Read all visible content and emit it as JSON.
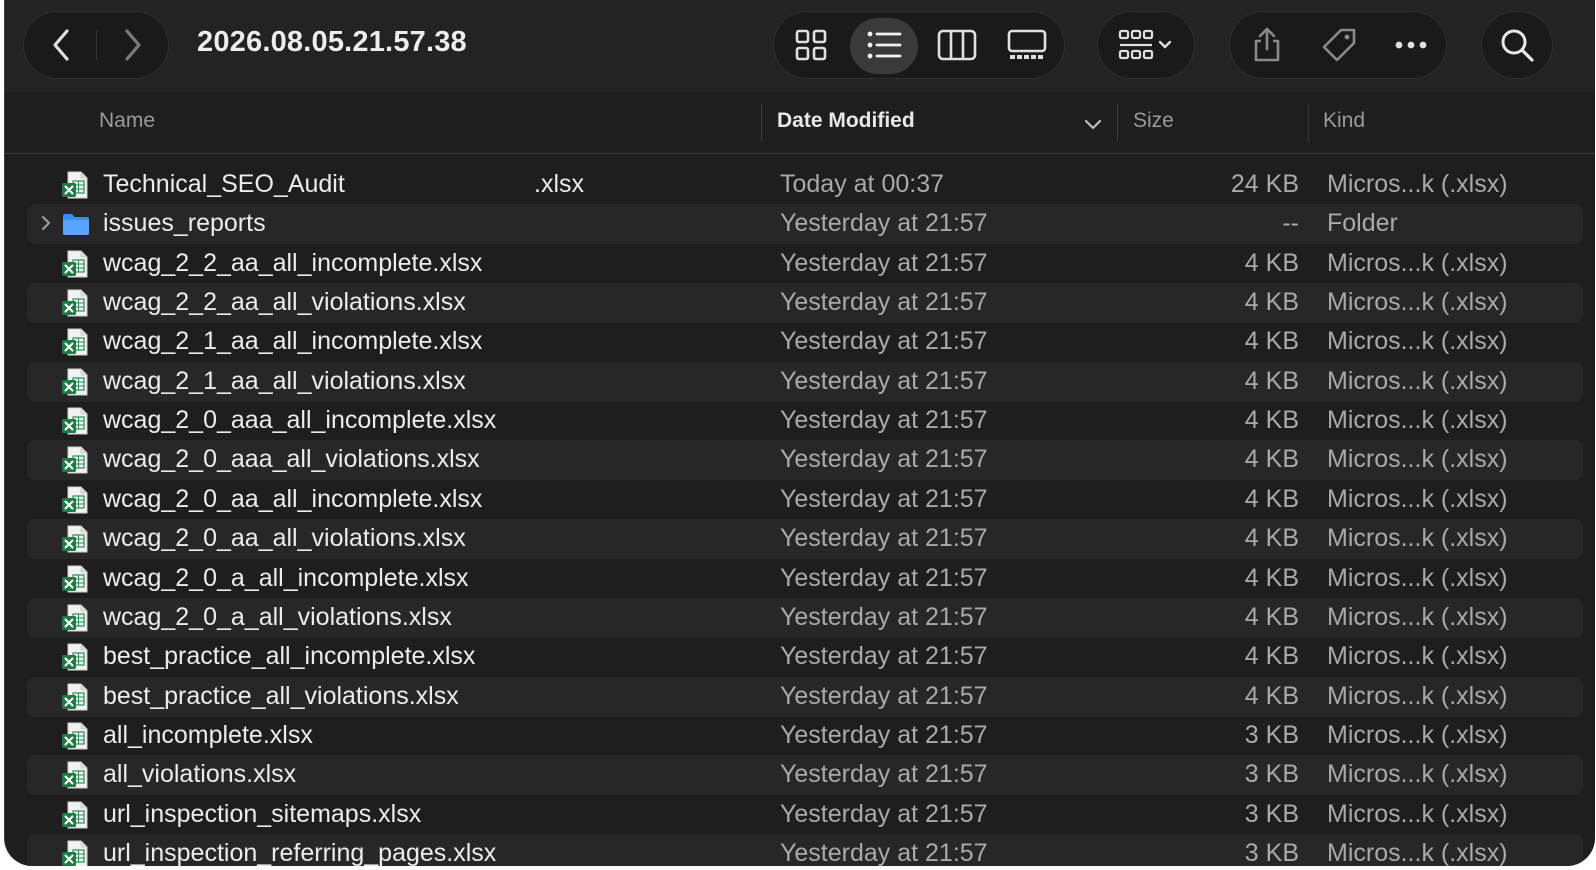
{
  "window": {
    "title": "2026.08.05.21.57.38"
  },
  "toolbar": {
    "back_icon": "chevron-left-icon",
    "forward_icon": "chevron-right-icon",
    "views": [
      "icon-view-icon",
      "list-view-icon",
      "column-view-icon",
      "gallery-view-icon"
    ],
    "active_view": "list-view-icon",
    "group_icon": "group-by-icon",
    "share_icon": "share-icon",
    "tag_icon": "tag-icon",
    "more_icon": "more-icon",
    "search_icon": "search-icon"
  },
  "columns": {
    "name": "Name",
    "date": "Date Modified",
    "size": "Size",
    "kind": "Kind"
  },
  "files": [
    {
      "name": "Technical_SEO_Audit",
      "name_suffix": ".xlsx",
      "date": "Today at 00:37",
      "size": "24 KB",
      "kind": "Micros...k (.xlsx)",
      "type": "xlsx"
    },
    {
      "name": "issues_reports",
      "date": "Yesterday at 21:57",
      "size": "--",
      "kind": "Folder",
      "type": "folder"
    },
    {
      "name": "wcag_2_2_aa_all_incomplete.xlsx",
      "date": "Yesterday at 21:57",
      "size": "4 KB",
      "kind": "Micros...k (.xlsx)",
      "type": "xlsx"
    },
    {
      "name": "wcag_2_2_aa_all_violations.xlsx",
      "date": "Yesterday at 21:57",
      "size": "4 KB",
      "kind": "Micros...k (.xlsx)",
      "type": "xlsx"
    },
    {
      "name": "wcag_2_1_aa_all_incomplete.xlsx",
      "date": "Yesterday at 21:57",
      "size": "4 KB",
      "kind": "Micros...k (.xlsx)",
      "type": "xlsx"
    },
    {
      "name": "wcag_2_1_aa_all_violations.xlsx",
      "date": "Yesterday at 21:57",
      "size": "4 KB",
      "kind": "Micros...k (.xlsx)",
      "type": "xlsx"
    },
    {
      "name": "wcag_2_0_aaa_all_incomplete.xlsx",
      "date": "Yesterday at 21:57",
      "size": "4 KB",
      "kind": "Micros...k (.xlsx)",
      "type": "xlsx"
    },
    {
      "name": "wcag_2_0_aaa_all_violations.xlsx",
      "date": "Yesterday at 21:57",
      "size": "4 KB",
      "kind": "Micros...k (.xlsx)",
      "type": "xlsx"
    },
    {
      "name": "wcag_2_0_aa_all_incomplete.xlsx",
      "date": "Yesterday at 21:57",
      "size": "4 KB",
      "kind": "Micros...k (.xlsx)",
      "type": "xlsx"
    },
    {
      "name": "wcag_2_0_aa_all_violations.xlsx",
      "date": "Yesterday at 21:57",
      "size": "4 KB",
      "kind": "Micros...k (.xlsx)",
      "type": "xlsx"
    },
    {
      "name": "wcag_2_0_a_all_incomplete.xlsx",
      "date": "Yesterday at 21:57",
      "size": "4 KB",
      "kind": "Micros...k (.xlsx)",
      "type": "xlsx"
    },
    {
      "name": "wcag_2_0_a_all_violations.xlsx",
      "date": "Yesterday at 21:57",
      "size": "4 KB",
      "kind": "Micros...k (.xlsx)",
      "type": "xlsx"
    },
    {
      "name": "best_practice_all_incomplete.xlsx",
      "date": "Yesterday at 21:57",
      "size": "4 KB",
      "kind": "Micros...k (.xlsx)",
      "type": "xlsx"
    },
    {
      "name": "best_practice_all_violations.xlsx",
      "date": "Yesterday at 21:57",
      "size": "4 KB",
      "kind": "Micros...k (.xlsx)",
      "type": "xlsx"
    },
    {
      "name": "all_incomplete.xlsx",
      "date": "Yesterday at 21:57",
      "size": "3 KB",
      "kind": "Micros...k (.xlsx)",
      "type": "xlsx"
    },
    {
      "name": "all_violations.xlsx",
      "date": "Yesterday at 21:57",
      "size": "3 KB",
      "kind": "Micros...k (.xlsx)",
      "type": "xlsx"
    },
    {
      "name": "url_inspection_sitemaps.xlsx",
      "date": "Yesterday at 21:57",
      "size": "3 KB",
      "kind": "Micros...k (.xlsx)",
      "type": "xlsx"
    },
    {
      "name": "url_inspection_referring_pages.xlsx",
      "date": "Yesterday at 21:57",
      "size": "3 KB",
      "kind": "Micros...k (.xlsx)",
      "type": "xlsx"
    }
  ],
  "colors": {
    "background": "#1e1e1e",
    "row_alt": "#272727",
    "excel_green": "#1f7a45",
    "folder_blue": "#3b8ef5"
  }
}
